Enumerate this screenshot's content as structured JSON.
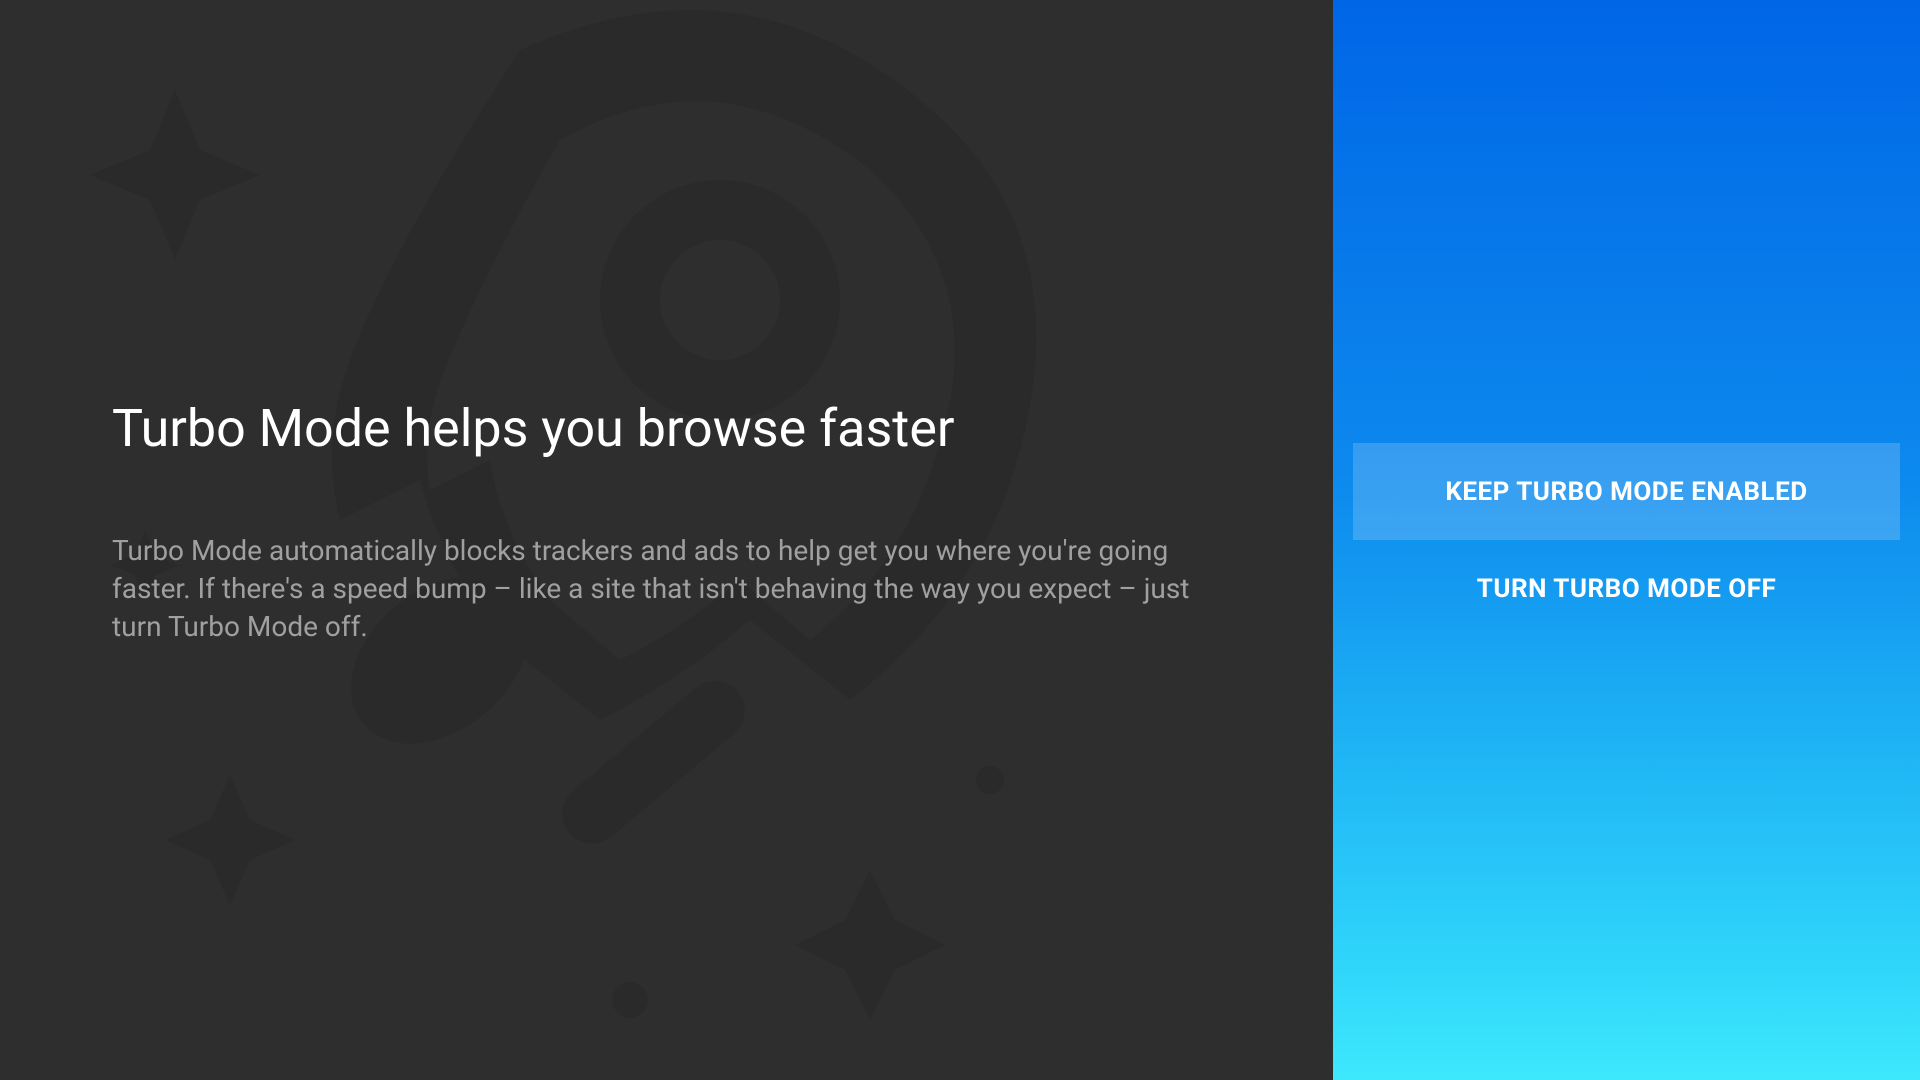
{
  "content": {
    "heading": "Turbo Mode helps you browse faster",
    "description": "Turbo Mode automatically blocks trackers and ads to help get you where you're going faster. If there's a speed bump – like a site that isn't behaving the way you expect – just turn Turbo Mode off."
  },
  "actions": {
    "keep_enabled_label": "KEEP TURBO MODE ENABLED",
    "turn_off_label": "TURN TURBO MODE OFF"
  },
  "colors": {
    "background_dark": "#2e2e2e",
    "gradient_top": "#0066e6",
    "gradient_bottom": "#3ee8fc",
    "text_white": "#ffffff",
    "text_muted": "#a0a0a0"
  }
}
